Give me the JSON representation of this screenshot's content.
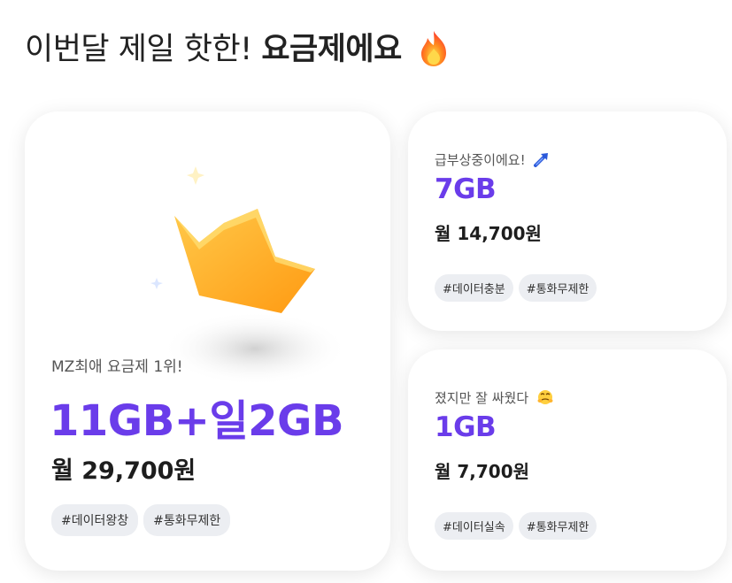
{
  "header": {
    "title_regular": "이번달 제일 핫한!",
    "title_bold": "요금제에요",
    "icon": "fire-icon"
  },
  "plans": [
    {
      "subtitle": "MZ최애 요금제 1위!",
      "data": "11GB+일2GB",
      "price": "월 29,700원",
      "tags": [
        "#데이터왕창",
        "#통화무제한"
      ],
      "icon": "crown-icon"
    },
    {
      "subtitle": "급부상중이에요!",
      "subtitle_icon": "rising-arrow-icon",
      "data": "7GB",
      "price": "월 14,700원",
      "tags": [
        "#데이터충분",
        "#통화무제한"
      ]
    },
    {
      "subtitle": "졌지만 잘 싸웠다",
      "subtitle_icon": "face-icon",
      "data": "1GB",
      "price": "월 7,700원",
      "tags": [
        "#데이터실속",
        "#통화무제한"
      ]
    }
  ],
  "colors": {
    "accent": "#6a3cea",
    "tag_bg": "#eceef2",
    "crown": "#ffa81f"
  }
}
